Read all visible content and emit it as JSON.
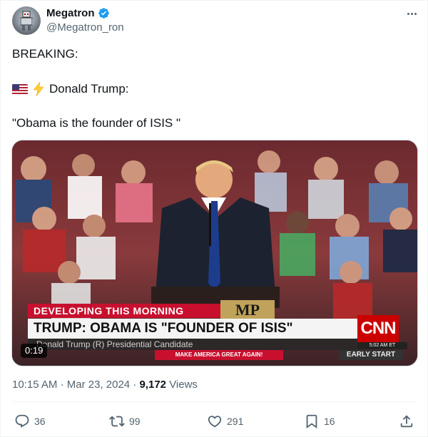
{
  "author": {
    "display_name": "Megatron",
    "handle": "@Megatron_ron",
    "verified": true,
    "verified_color": "#1d9bf0"
  },
  "tweet": {
    "line1": "BREAKING:",
    "line2_text": "Donald Trump:",
    "line2_emojis": [
      "us-flag-icon",
      "lightning-icon"
    ],
    "line3": "\"Obama is the founder of ISIS \""
  },
  "media": {
    "duration": "0:19",
    "overlay": {
      "developing": "DEVELOPING THIS MORNING",
      "mp_box": "MP",
      "headline": "TRUMP: OBAMA IS \"FOUNDER OF ISIS\"",
      "subline": "Donald Trump (R) Presidential Candidate",
      "maga": "MAKE AMERICA GREAT AGAIN!",
      "network": "CNN",
      "time": "5:02 AM ET",
      "show": "EARLY START"
    }
  },
  "meta": {
    "time": "10:15 AM",
    "date": "Mar 23, 2024",
    "views_count": "9,172",
    "views_label": "Views"
  },
  "actions": {
    "replies": "36",
    "retweets": "99",
    "likes": "291",
    "bookmarks": "16"
  },
  "colors": {
    "text_primary": "#0f1419",
    "text_secondary": "#536471",
    "cnn_red": "#cc0000",
    "chyron_red": "#c8102e"
  }
}
